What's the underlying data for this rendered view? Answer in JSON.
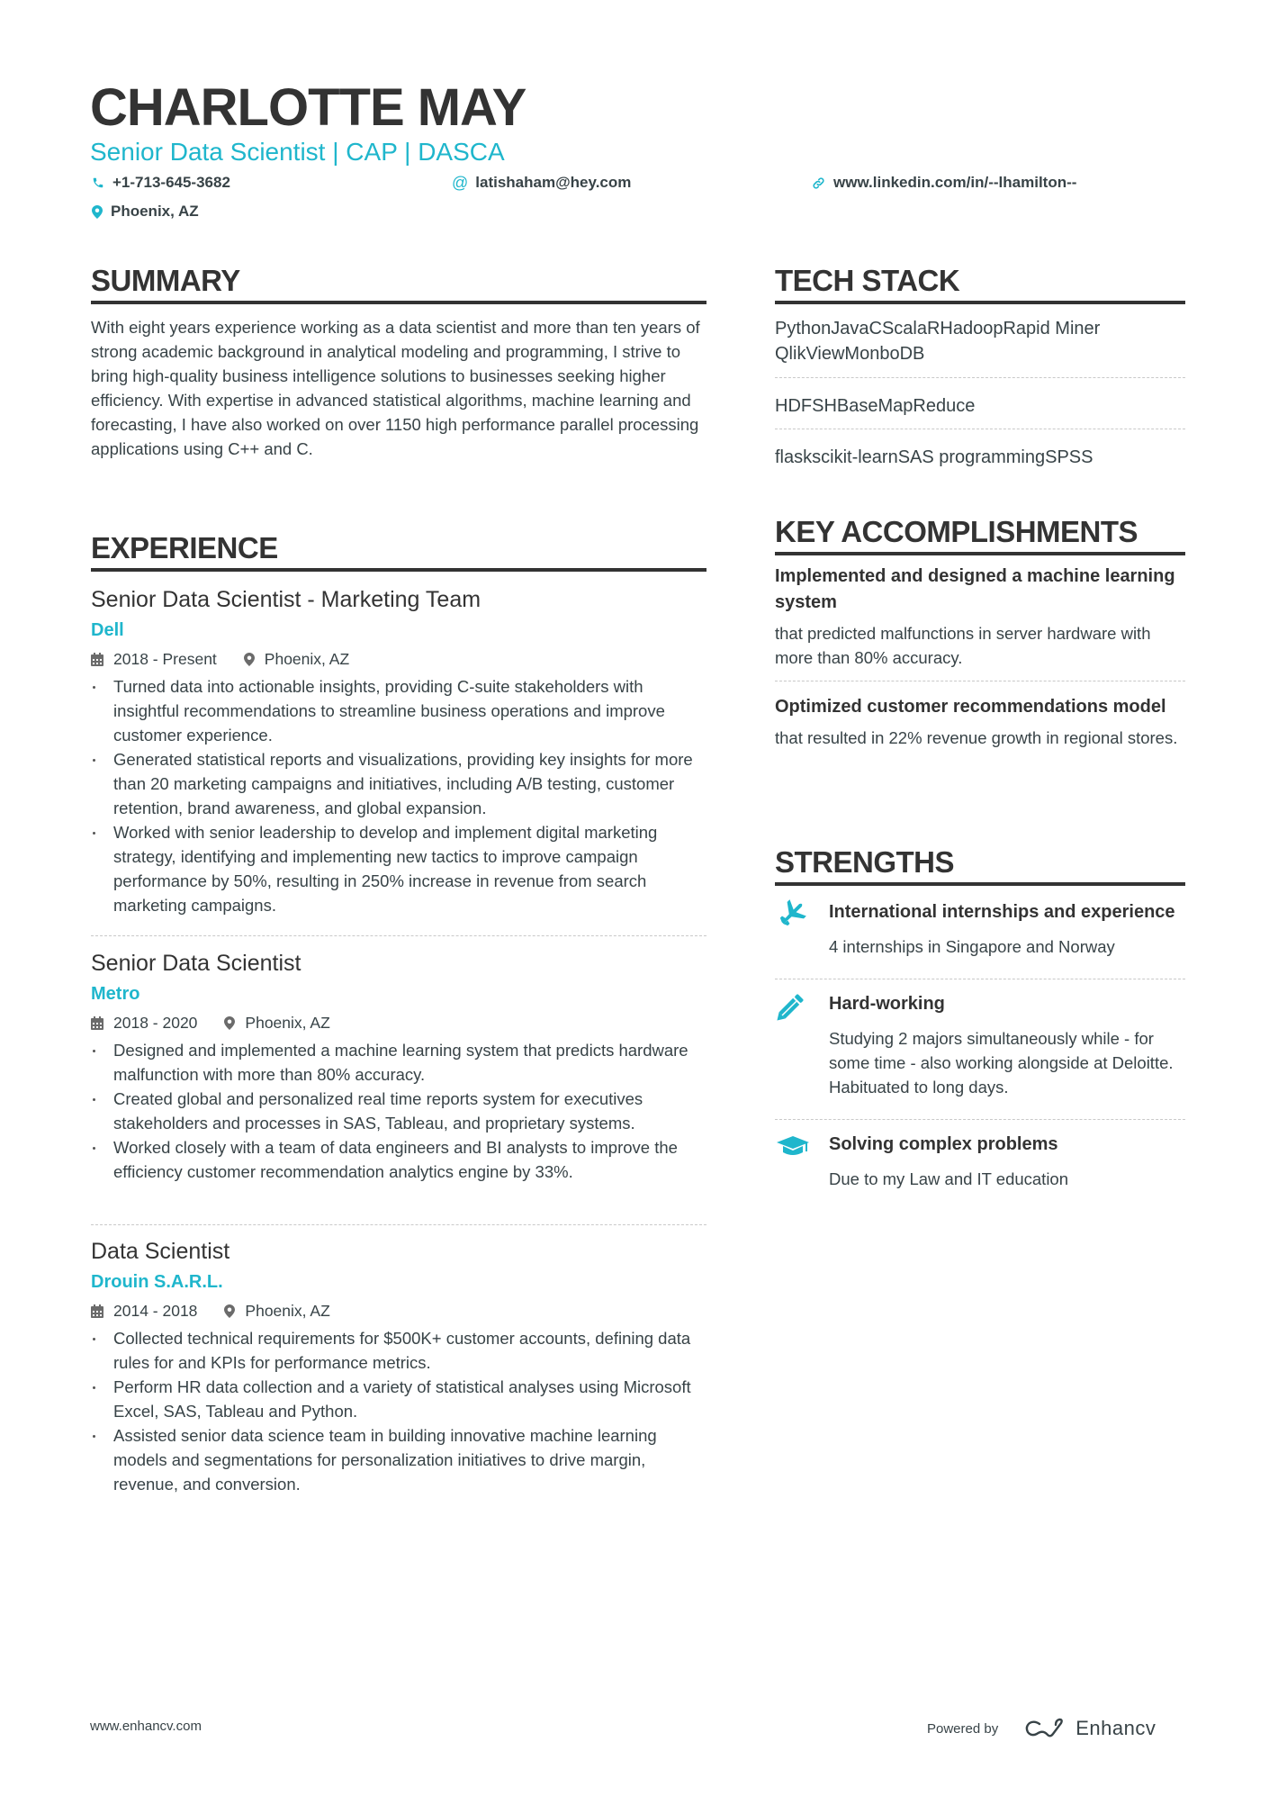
{
  "header": {
    "name": "CHARLOTTE MAY",
    "title": "Senior Data Scientist | CAP | DASCA",
    "phone": "+1-713-645-3682",
    "email": "latishaham@hey.com",
    "linkedin": "www.linkedin.com/in/--lhamilton--",
    "location": "Phoenix, AZ",
    "icons": {
      "phone": "phone-icon",
      "email": "at-icon",
      "linkedin": "link-icon",
      "location": "map-pin-icon"
    }
  },
  "summary": {
    "heading": "SUMMARY",
    "text": "With eight years experience working as a data scientist and more than ten years of strong academic background in analytical modeling and programming, I strive to bring high-quality business intelligence solutions to businesses seeking higher efficiency. With expertise in advanced statistical algorithms, machine learning and forecasting, I have also worked on over 1150 high performance parallel processing applications using C++ and C."
  },
  "experience": {
    "heading": "EXPERIENCE",
    "jobs": [
      {
        "title": "Senior Data Scientist - Marketing Team",
        "company": "Dell",
        "dates": "2018 - Present",
        "location": "Phoenix, AZ",
        "bullets": [
          "Turned data into actionable insights, providing C-suite stakeholders with insightful recommendations to streamline business operations and improve customer experience.",
          "Generated statistical reports and visualizations, providing key insights for more than 20 marketing campaigns and initiatives, including A/B testing, customer retention, brand awareness, and global expansion.",
          "Worked with senior leadership to develop and implement digital marketing strategy, identifying and implementing new tactics to improve campaign performance by 50%, resulting in 250% increase in revenue from search marketing campaigns."
        ]
      },
      {
        "title": "Senior Data Scientist",
        "company": "Metro",
        "dates": "2018 - 2020",
        "location": "Phoenix, AZ",
        "bullets": [
          "Designed and implemented a machine learning system that predicts hardware malfunction with more than 80% accuracy.",
          "Created global and personalized real time reports system for executives stakeholders and processes in SAS, Tableau, and proprietary systems.",
          "Worked closely with a team of data engineers and BI analysts to improve the efficiency customer recommendation analytics engine by 33%."
        ]
      },
      {
        "title": "Data Scientist",
        "company": "Drouin S.A.R.L.",
        "dates": "2014 - 2018",
        "location": "Phoenix, AZ",
        "bullets": [
          "Collected technical requirements for $500K+ customer accounts, defining data rules for and KPIs for performance metrics.",
          "Perform HR data collection and a variety of statistical analyses using Microsoft Excel, SAS, Tableau and Python.",
          "Assisted senior data science team in building innovative machine learning models and segmentations for personalization initiatives to drive margin, revenue, and conversion."
        ]
      }
    ]
  },
  "tech_stack": {
    "heading": "TECH STACK",
    "items": [
      "PythonJavaCScalaRHadoopRapid Miner QlikViewMonboDB",
      "HDFSHBaseMapReduce",
      "flaskscikit-learnSAS programmingSPSS"
    ]
  },
  "accomplishments": {
    "heading": "KEY ACCOMPLISHMENTS",
    "items": [
      {
        "title": "Implemented and designed a machine learning system",
        "desc": "that predicted malfunctions in server hardware with more than 80% accuracy."
      },
      {
        "title": "Optimized customer recommendations model",
        "desc": "that resulted in 22% revenue growth in regional stores."
      }
    ]
  },
  "strengths": {
    "heading": "STRENGTHS",
    "items": [
      {
        "icon": "plane-icon",
        "title": "International internships and experience",
        "desc": "4 internships in Singapore and Norway"
      },
      {
        "icon": "pencil-icon",
        "title": "Hard-working",
        "desc": "Studying 2 majors simultaneously while - for some time - also working alongside at Deloitte. Habituated to long days."
      },
      {
        "icon": "graduation-cap-icon",
        "title": "Solving complex problems",
        "desc": "Due to my Law and IT education"
      }
    ]
  },
  "footer": {
    "url": "www.enhancv.com",
    "powered_by": "Powered by",
    "brand": "Enhancv"
  },
  "colors": {
    "accent": "#1fb6cc",
    "text": "#384347",
    "heading": "#333333"
  }
}
